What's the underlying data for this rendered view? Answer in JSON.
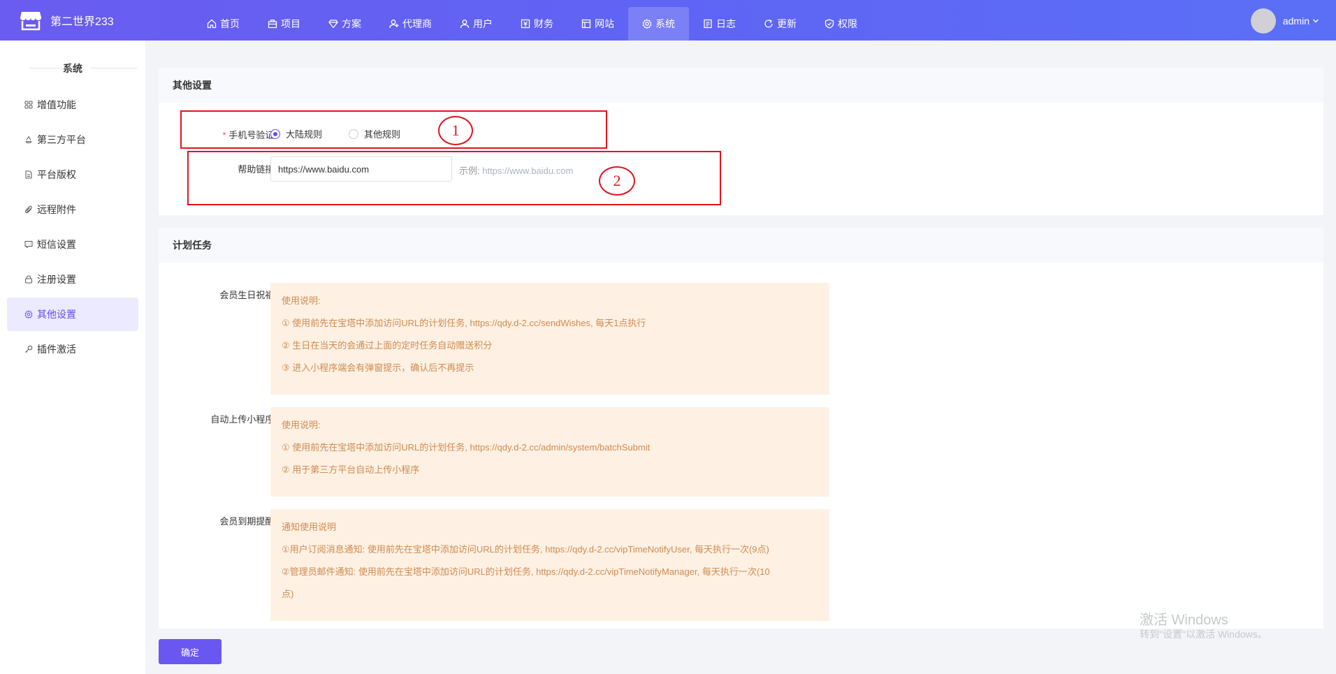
{
  "header": {
    "app_name": "第二世界233",
    "nav": [
      {
        "label": "首页",
        "icon": "home-icon"
      },
      {
        "label": "项目",
        "icon": "box-icon"
      },
      {
        "label": "方案",
        "icon": "diamond-icon"
      },
      {
        "label": "代理商",
        "icon": "agent-icon"
      },
      {
        "label": "用户",
        "icon": "users-icon"
      },
      {
        "label": "财务",
        "icon": "finance-icon"
      },
      {
        "label": "网站",
        "icon": "website-icon"
      },
      {
        "label": "系统",
        "icon": "gear-icon"
      },
      {
        "label": "日志",
        "icon": "log-icon"
      },
      {
        "label": "更新",
        "icon": "refresh-icon"
      },
      {
        "label": "权限",
        "icon": "shield-icon"
      }
    ],
    "active_nav": "系统",
    "username": "admin"
  },
  "sidebar": {
    "title": "系统",
    "items": [
      {
        "label": "增值功能",
        "icon": "grid-icon"
      },
      {
        "label": "第三方平台",
        "icon": "recycle-icon"
      },
      {
        "label": "平台版权",
        "icon": "document-icon"
      },
      {
        "label": "远程附件",
        "icon": "paperclip-icon"
      },
      {
        "label": "短信设置",
        "icon": "message-icon"
      },
      {
        "label": "注册设置",
        "icon": "lock-icon"
      },
      {
        "label": "其他设置",
        "icon": "gear-icon"
      },
      {
        "label": "插件激活",
        "icon": "key-icon"
      }
    ],
    "active_item": "其他设置"
  },
  "other_settings": {
    "title": "其他设置",
    "phone_verify": {
      "required_mark": "*",
      "label": "手机号验证:",
      "options": [
        "大陆规则",
        "其他规则"
      ],
      "selected": "大陆规则"
    },
    "help_link": {
      "label": "帮助链接:",
      "value": "https://www.baidu.com",
      "hint_prefix": "示例:",
      "hint_url": "https://www.baidu.com"
    },
    "annotations": [
      "1",
      "2"
    ]
  },
  "scheduled_tasks": {
    "title": "计划任务",
    "birthday": {
      "label": "会员生日祝福:",
      "lines": [
        "使用说明:",
        "① 使用前先在宝塔中添加访问URL的计划任务, https://qdy.d-2.cc/sendWishes, 每天1点执行",
        "② 生日在当天的会通过上面的定时任务自动赠送积分",
        "③ 进入小程序端会有弹窗提示，确认后不再提示"
      ]
    },
    "upload": {
      "label": "自动上传小程序:",
      "lines": [
        "使用说明:",
        "① 使用前先在宝塔中添加访问URL的计划任务, https://qdy.d-2.cc/admin/system/batchSubmit",
        "② 用于第三方平台自动上传小程序"
      ]
    },
    "expire": {
      "label": "会员到期提醒:",
      "lines": [
        "通知使用说明",
        "①用户订阅消息通知: 使用前先在宝塔中添加访问URL的计划任务, https://qdy.d-2.cc/vipTimeNotifyUser, 每天执行一次(9点)",
        "②管理员邮件通知: 使用前先在宝塔中添加访问URL的计划任务, https://qdy.d-2.cc/vipTimeNotifyManager, 每天执行一次(10",
        "点)"
      ]
    }
  },
  "footer": {
    "confirm_label": "确定"
  },
  "watermark": {
    "line1": "激活 Windows",
    "line2": "转到\"设置\"以激活 Windows。"
  },
  "colors": {
    "brand": "#6a5cf0",
    "accent": "#5f4ff0",
    "annotation": "#e0141e",
    "notice_bg": "#fef1e3",
    "notice_text": "#cf8a52"
  }
}
